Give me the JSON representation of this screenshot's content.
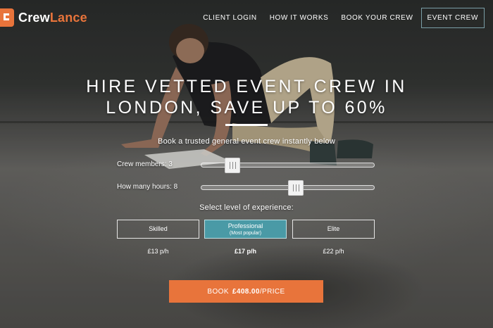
{
  "brand": {
    "name_part1": "Crew",
    "name_part2": "Lance",
    "accent": "#e8743b"
  },
  "nav": {
    "items": [
      "CLIENT LOGIN",
      "HOW IT WORKS",
      "BOOK YOUR CREW"
    ],
    "active_item": "EVENT CREW"
  },
  "hero": {
    "title_line1": "HIRE VETTED EVENT CREW IN",
    "title_line2": "LONDON, SAVE UP TO 60%",
    "subtitle": "Book a trusted general event crew instantly below"
  },
  "crew_slider": {
    "label": "Crew members: 3",
    "value": 3,
    "fraction": 0.15
  },
  "hours_slider": {
    "label": "How many hours: 8",
    "value": 8,
    "fraction": 0.55
  },
  "experience": {
    "label": "Select level of experience:",
    "options": [
      {
        "label": "Skilled",
        "sub": "",
        "price": "£13 p/h"
      },
      {
        "label": "Professional",
        "sub": "(Most popular)",
        "price": "£17 p/h"
      },
      {
        "label": "Elite",
        "sub": "",
        "price": "£22 p/h"
      }
    ],
    "selected": "Professional",
    "selected_color": "#4a9aa6"
  },
  "book_button": {
    "prefix": "BOOK",
    "amount": "£408.00",
    "suffix": "/PRICE"
  }
}
